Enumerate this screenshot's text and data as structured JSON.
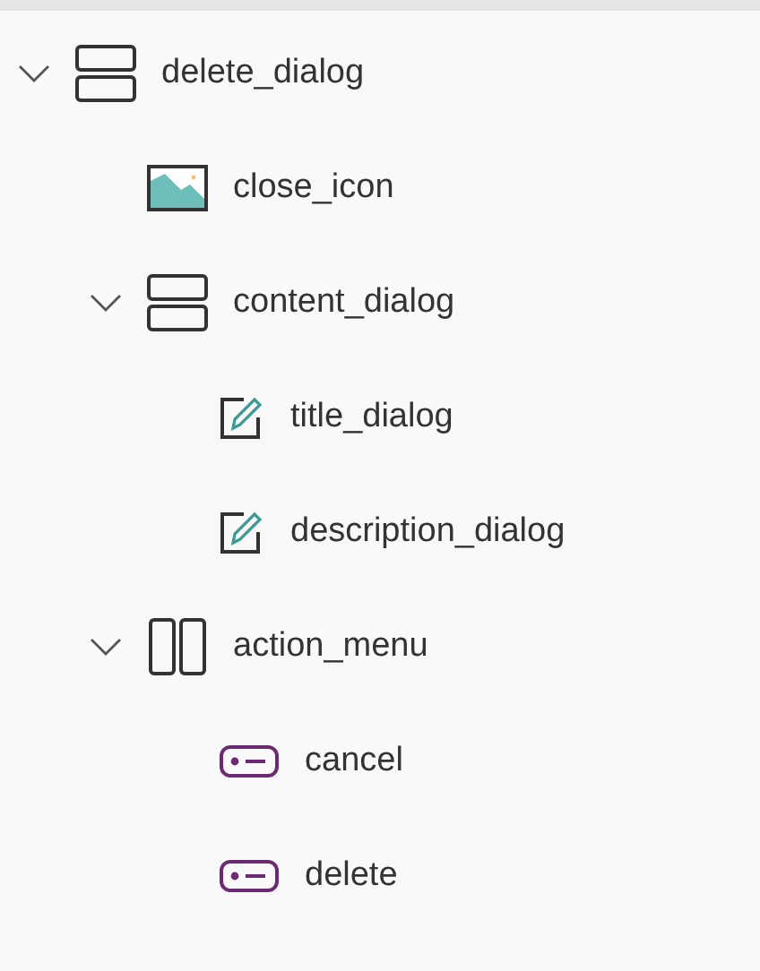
{
  "tree": [
    {
      "label": "delete_dialog",
      "kind": "vertical",
      "expanded": true,
      "children": [
        {
          "label": "close_icon",
          "kind": "image"
        },
        {
          "label": "content_dialog",
          "kind": "vertical",
          "expanded": true,
          "children": [
            {
              "label": "title_dialog",
              "kind": "text"
            },
            {
              "label": "description_dialog",
              "kind": "text"
            }
          ]
        },
        {
          "label": "action_menu",
          "kind": "horizontal",
          "expanded": true,
          "children": [
            {
              "label": "cancel",
              "kind": "button"
            },
            {
              "label": "delete",
              "kind": "button"
            }
          ]
        }
      ]
    }
  ]
}
